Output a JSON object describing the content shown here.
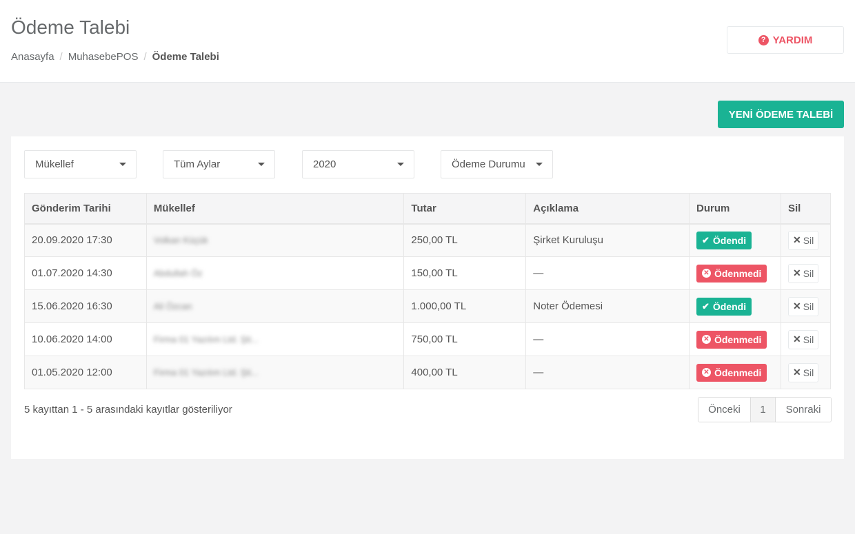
{
  "header": {
    "title": "Ödeme Talebi",
    "breadcrumb": [
      "Anasayfa",
      "MuhasebePOS",
      "Ödeme Talebi"
    ],
    "help_label": "YARDIM"
  },
  "actions": {
    "new_label": "YENİ ÖDEME TALEBİ"
  },
  "filters": [
    "Mükellef",
    "Tüm Aylar",
    "2020",
    "Ödeme Durumu"
  ],
  "table": {
    "columns": [
      "Gönderim Tarihi",
      "Mükellef",
      "Tutar",
      "Açıklama",
      "Durum",
      "Sil"
    ],
    "rows": [
      {
        "date": "20.09.2020 17:30",
        "payer": "Volkan Küçük",
        "amount": "250,00 TL",
        "desc": "Şirket Kuruluşu",
        "status": "Ödendi",
        "paid": true
      },
      {
        "date": "01.07.2020 14:30",
        "payer": "Abdullah Öz",
        "amount": "150,00 TL",
        "desc": "—",
        "status": "Ödenmedi",
        "paid": false
      },
      {
        "date": "15.06.2020 16:30",
        "payer": "Ali Özcan",
        "amount": "1.000,00 TL",
        "desc": "Noter Ödemesi",
        "status": "Ödendi",
        "paid": true
      },
      {
        "date": "10.06.2020 14:00",
        "payer": "Firma 01 Yazılım Ltd. Şti...",
        "amount": "750,00 TL",
        "desc": "—",
        "status": "Ödenmedi",
        "paid": false
      },
      {
        "date": "01.05.2020 12:00",
        "payer": "Firma 01 Yazılım Ltd. Şti...",
        "amount": "400,00 TL",
        "desc": "—",
        "status": "Ödenmedi",
        "paid": false
      }
    ],
    "delete_label": "Sil"
  },
  "footer": {
    "info": "5 kayıttan 1 - 5 arasındaki kayıtlar gösteriliyor",
    "prev": "Önceki",
    "page": "1",
    "next": "Sonraki"
  },
  "colors": {
    "accent": "#1ab394",
    "danger": "#ed5565"
  }
}
